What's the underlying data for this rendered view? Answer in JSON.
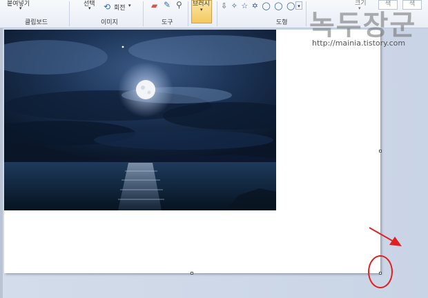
{
  "ribbon": {
    "paste_label": "붙여넣기",
    "select_label": "선택",
    "rotate_label": "회전",
    "brush_label": "브러시",
    "size_label": "크기",
    "color1_label": "색",
    "color2_label": "색",
    "groups": {
      "clipboard": "클립보드",
      "image": "이미지",
      "tools": "도구",
      "shapes": "도형"
    },
    "shape_glyphs": "⇩ ✧ ☆ ✡ ◯ ◯ ◯"
  },
  "watermark": {
    "title": "녹두장군",
    "url": "http://mainia.tistory.com"
  },
  "colors": {
    "annotation": "#e02020",
    "ribbon_bg": "#eef2f8",
    "workspace_bg": "#cdd7e6"
  }
}
